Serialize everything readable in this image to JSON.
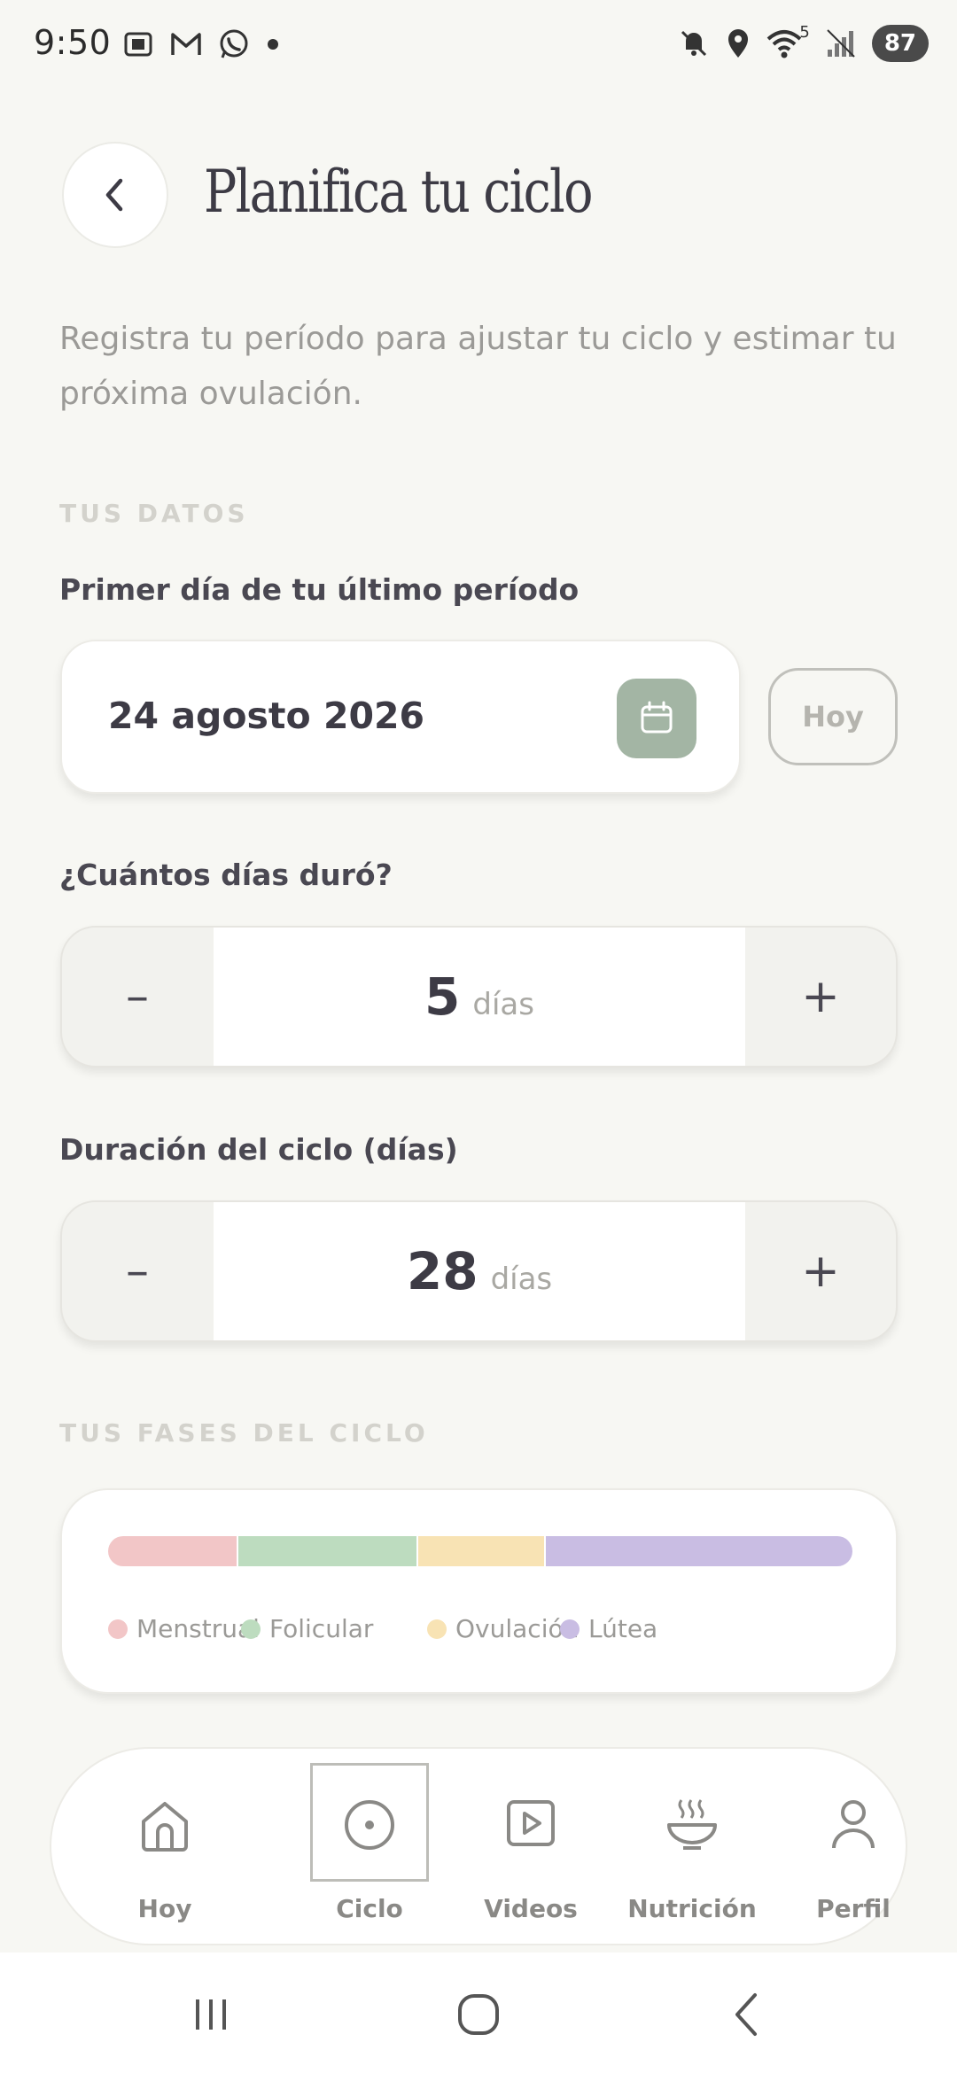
{
  "status_bar": {
    "time": "9:50",
    "signal_label": "5",
    "battery": "87",
    "left_icons": [
      "screenshot-icon",
      "gmail-icon",
      "whatsapp-icon",
      "dot-icon"
    ],
    "right_icons": [
      "mute-icon",
      "location-icon",
      "wifi-icon",
      "signal-icon",
      "battery-icon"
    ]
  },
  "header": {
    "title": "Planifica tu ciclo",
    "subtitle": "Registra tu período para ajustar tu ciclo y estimar tu próxima ovulación."
  },
  "sections": {
    "data_label": "TUS DATOS",
    "phases_label": "TUS FASES DEL CICLO"
  },
  "last_period": {
    "label": "Primer día de tu último período",
    "value": "24 agosto 2026",
    "today_button": "Hoy"
  },
  "period_length": {
    "label": "¿Cuántos días duró?",
    "value": "5",
    "unit": "días",
    "minus": "–",
    "plus": "+"
  },
  "cycle_length": {
    "label": "Duración del ciclo (días)",
    "value": "28",
    "unit": "días",
    "minus": "–",
    "plus": "+"
  },
  "phases": [
    {
      "name": "Menstrual",
      "days": 5,
      "color": "#f2c6c7"
    },
    {
      "name": "Folicular",
      "days": 7,
      "color": "#bddcbf"
    },
    {
      "name": "Ovulación",
      "days": 5,
      "color": "#f8e3b4"
    },
    {
      "name": "Lútea",
      "days": 12,
      "color": "#c9bde3"
    }
  ],
  "bottom_nav": {
    "items": [
      {
        "label": "Hoy",
        "icon": "home-icon"
      },
      {
        "label": "Ciclo",
        "icon": "cycle-icon",
        "selected": true
      },
      {
        "label": "Videos",
        "icon": "video-icon"
      },
      {
        "label": "Nutrición",
        "icon": "bowl-icon"
      },
      {
        "label": "Perfil",
        "icon": "profile-icon"
      }
    ]
  },
  "colors": {
    "background": "#f7f7f3",
    "accent_green": "#a3b5a4",
    "text_dark": "#3d3b45"
  }
}
